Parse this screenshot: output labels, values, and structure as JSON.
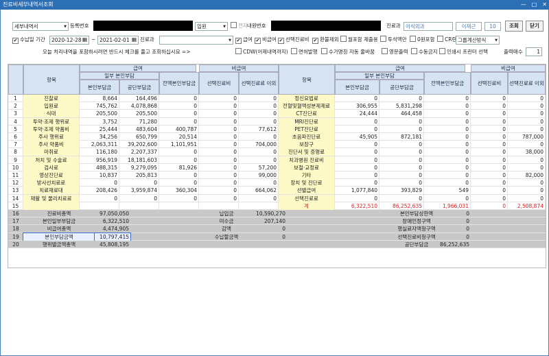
{
  "window": {
    "title": "진료비세부내역서조회",
    "min": "—",
    "max": "□",
    "close": "✕"
  },
  "toolbar": {
    "report_select": "세부내역서",
    "reg_label": "등록번호",
    "visit_select": "입원",
    "e_label": "전자",
    "chart_label": "내원번호",
    "dept_label": "진료과",
    "dept_value": "이식외과",
    "doctor_value": "이재근",
    "doctor_code": "10",
    "search_btn": "조회",
    "close_btn": "닫기",
    "period_label": "수납일 기간",
    "date_from": "2020-12-28",
    "tilde": "~",
    "date_to": "2021-02-01",
    "dept2_label": "진료과",
    "chk_benefit": "급여",
    "chk_nonbenefit": "비급여",
    "chk_select": "선택진료비",
    "chk_payback": "환불제외",
    "chk_monthly": "월포함 제출용",
    "chk_special": "투석액만",
    "chk_zero": "0원포함",
    "chk_cr": "CR란",
    "group_select": "그룹계산방식",
    "notice": "오늘 처리내역을 포함하시려면 반드시 체크를 풀고 조회하십시요 =>",
    "chk_cdw": "CDW(어제내역까지)",
    "chk_free": "면허발행",
    "chk_auto": "수가명칭 자동 줄바꿈",
    "chk_print": "영문출력",
    "chk_fee": "수동금지",
    "chk_pinprint": "인쇄시 프린터 선택",
    "copies_label": "출력매수",
    "copies_value": "1"
  },
  "grid": {
    "h_item": "항목",
    "h_benefit": "급여",
    "h_nonbenefit": "비급여",
    "h_self_part": "일부 본인부담",
    "h_self": "본인부담금",
    "h_public": "공단부담금",
    "h_full": "전액본인부담금",
    "h_select": "선택진료비",
    "h_select_other": "선택진료료 이외",
    "rows": [
      {
        "n": "1",
        "l": "진찰료",
        "a": "8,664",
        "b": "164,496",
        "c": "0",
        "d": "0",
        "e": "0",
        "l2": "정신요법료",
        "a2": "0",
        "b2": "0",
        "c2": "0",
        "d2": "0",
        "e2": "0"
      },
      {
        "n": "2",
        "l": "입원료",
        "a": "745,762",
        "b": "4,078,868",
        "c": "0",
        "d": "0",
        "e": "0",
        "l2": "전혈및혈액성분제제료",
        "a2": "306,955",
        "b2": "5,831,298",
        "c2": "0",
        "d2": "0",
        "e2": "0"
      },
      {
        "n": "3",
        "l": "식대",
        "a": "205,500",
        "b": "205,500",
        "c": "0",
        "d": "0",
        "e": "0",
        "l2": "CT진단료",
        "a2": "24,444",
        "b2": "464,458",
        "c2": "0",
        "d2": "0",
        "e2": "0"
      },
      {
        "n": "4",
        "l": "투약·조제 행위료",
        "a": "3,752",
        "b": "71,280",
        "c": "0",
        "d": "0",
        "e": "0",
        "l2": "MRI진단료",
        "a2": "0",
        "b2": "0",
        "c2": "0",
        "d2": "0",
        "e2": "0"
      },
      {
        "n": "5",
        "l": "투약·조제 약품비",
        "a": "25,444",
        "b": "483,604",
        "c": "400,787",
        "d": "0",
        "e": "77,612",
        "l2": "PET진단료",
        "a2": "0",
        "b2": "0",
        "c2": "0",
        "d2": "0",
        "e2": "0"
      },
      {
        "n": "6",
        "l": "주사 행위료",
        "a": "34,256",
        "b": "650,799",
        "c": "20,514",
        "d": "0",
        "e": "0",
        "l2": "초음파진단료",
        "a2": "45,905",
        "b2": "872,181",
        "c2": "0",
        "d2": "0",
        "e2": "787,000"
      },
      {
        "n": "7",
        "l": "주사 약품비",
        "a": "2,063,311",
        "b": "39,202,600",
        "c": "1,101,951",
        "d": "0",
        "e": "704,000",
        "l2": "보장구",
        "a2": "0",
        "b2": "0",
        "c2": "0",
        "d2": "0",
        "e2": "0"
      },
      {
        "n": "8",
        "l": "마취료",
        "a": "116,180",
        "b": "2,207,337",
        "c": "0",
        "d": "0",
        "e": "0",
        "l2": "진단서 및 증명료",
        "a2": "0",
        "b2": "0",
        "c2": "0",
        "d2": "0",
        "e2": "38,000"
      },
      {
        "n": "9",
        "l": "처치 및 수술료",
        "a": "956,919",
        "b": "18,181,603",
        "c": "0",
        "d": "0",
        "e": "0",
        "l2": "치과병원 진료비",
        "a2": "0",
        "b2": "0",
        "c2": "0",
        "d2": "0",
        "e2": "0"
      },
      {
        "n": "10",
        "l": "검사료",
        "a": "488,315",
        "b": "9,279,095",
        "c": "81,926",
        "d": "0",
        "e": "57,200",
        "l2": "보철·교정료",
        "a2": "0",
        "b2": "0",
        "c2": "0",
        "d2": "0",
        "e2": "0"
      },
      {
        "n": "11",
        "l": "영상진단료",
        "a": "10,837",
        "b": "205,813",
        "c": "0",
        "d": "0",
        "e": "99,000",
        "l2": "기타",
        "a2": "0",
        "b2": "0",
        "c2": "0",
        "d2": "0",
        "e2": "82,000"
      },
      {
        "n": "12",
        "l": "방사선치료료",
        "a": "0",
        "b": "0",
        "c": "0",
        "d": "0",
        "e": "0",
        "l2": "장치 및 진단료",
        "a2": "0",
        "b2": "0",
        "c2": "0",
        "d2": "0",
        "e2": "0"
      },
      {
        "n": "13",
        "l": "치료재료대",
        "a": "208,426",
        "b": "3,959,874",
        "c": "360,304",
        "d": "0",
        "e": "664,062",
        "l2": "선별급여",
        "a2": "1,077,840",
        "b2": "393,829",
        "c2": "549",
        "d2": "0",
        "e2": "0"
      },
      {
        "n": "14",
        "l": "재활 및 물리치료료",
        "a": "0",
        "b": "0",
        "c": "0",
        "d": "0",
        "e": "0",
        "l2": "선택진료료",
        "a2": "0",
        "b2": "0",
        "c2": "0",
        "d2": "0",
        "e2": "0"
      },
      {
        "n": "15",
        "l": "",
        "a": "",
        "b": "",
        "c": "",
        "d": "",
        "e": "",
        "l2": "계",
        "a2": "6,322,510",
        "b2": "86,252,635",
        "c2": "1,966,031",
        "d2": "0",
        "e2": "2,508,874"
      }
    ],
    "summary": [
      {
        "n": "16",
        "l1": "진료비총액",
        "v1": "97,050,050",
        "l2": "납입금",
        "v2": "10,590,270",
        "l3": "본인부담상한액",
        "v3": "0"
      },
      {
        "n": "17",
        "l1": "본인일부부담금",
        "v1": "6,322,510",
        "l2": "미수금",
        "v2": "207,140",
        "l3": "장애인정구액",
        "v3": "0"
      },
      {
        "n": "18",
        "l1": "비급여총액",
        "v1": "4,474,905",
        "l2": "감액",
        "v2": "0",
        "l3": "행실료자액청구액",
        "v3": "0"
      },
      {
        "n": "19",
        "l1": "본인부담금액",
        "v1": "10,797,415",
        "l2": "수납할금액",
        "v2": "0",
        "l3": "선택진료비청구액",
        "v3": "0"
      },
      {
        "n": "20",
        "l1": "행위별금액총액",
        "v1": "45,808,195",
        "l2": "",
        "v2": "",
        "l3": "공단부담금",
        "v3": "86,252,635"
      }
    ]
  }
}
